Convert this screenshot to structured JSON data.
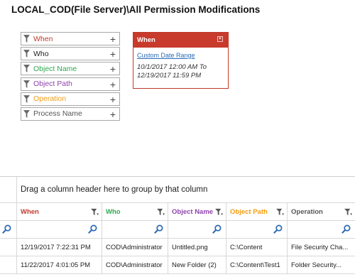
{
  "page": {
    "title": "LOCAL_COD(File Server)\\All Permission Modifications"
  },
  "filters": [
    {
      "label": "When",
      "color": "#c0392b",
      "icon": "filter-icon"
    },
    {
      "label": "Who",
      "color": "#222222",
      "icon": "filter-icon"
    },
    {
      "label": "Object Name",
      "color": "#2ea84f",
      "icon": "filter-icon"
    },
    {
      "label": "Object Path",
      "color": "#8e44ad",
      "icon": "filter-icon"
    },
    {
      "label": "Operation",
      "color": "#f39c12",
      "icon": "filter-icon"
    },
    {
      "label": "Process Name",
      "color": "#555555",
      "icon": "filter-icon"
    }
  ],
  "when_panel": {
    "title": "When",
    "link": "Custom Date Range",
    "range_line1": "10/1/2017 12:00 AM To",
    "range_line2": "12/19/2017 11:59 PM",
    "header_color": "#c73a2c"
  },
  "grid": {
    "group_hint": "Drag a column header here to group by that column",
    "columns": [
      {
        "label": "When",
        "color": "#c0392b"
      },
      {
        "label": "Who",
        "color": "#2ea84f"
      },
      {
        "label": "Object Name",
        "color": "#8e44ad"
      },
      {
        "label": "Object Path",
        "color": "#f39c12"
      },
      {
        "label": "Operation",
        "color": "#555555"
      }
    ],
    "rows": [
      [
        "12/19/2017 7:22:31 PM",
        "COD\\Administrator",
        "Untitled.png",
        "C:\\Content",
        "File Security Cha..."
      ],
      [
        "11/22/2017 4:01:05 PM",
        "COD\\Administrator",
        "New Folder (2)",
        "C:\\Content\\Test1",
        "Folder Security..."
      ]
    ]
  }
}
